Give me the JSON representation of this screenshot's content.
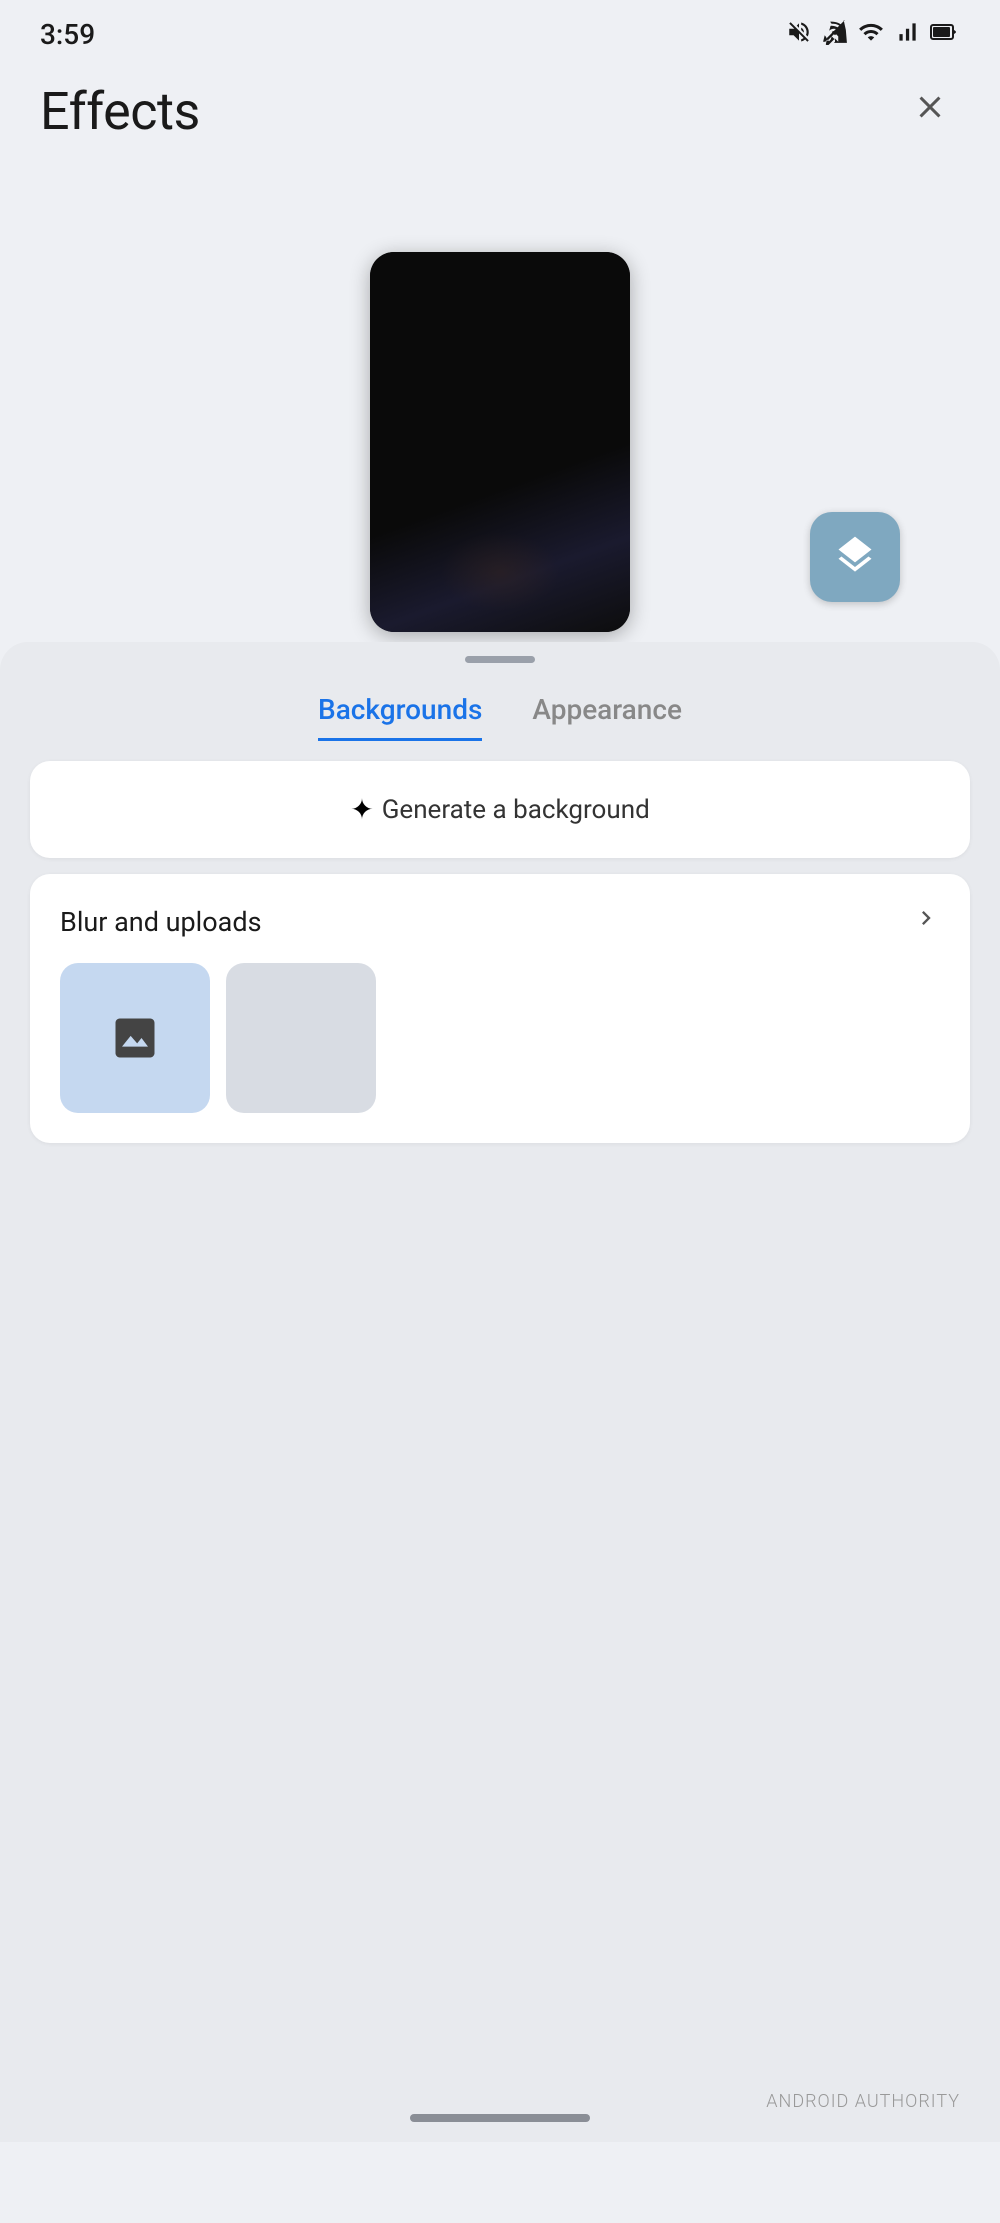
{
  "statusBar": {
    "time": "3:59",
    "icons": [
      "mute",
      "phone-wifi",
      "wifi",
      "signal",
      "battery"
    ]
  },
  "header": {
    "title": "Effects",
    "closeLabel": "×"
  },
  "tabs": [
    {
      "id": "backgrounds",
      "label": "Backgrounds",
      "active": true
    },
    {
      "id": "appearance",
      "label": "Appearance",
      "active": false
    }
  ],
  "generateBtn": {
    "icon": "✦",
    "label": " Generate a background"
  },
  "blurSection": {
    "title": "Blur and uploads",
    "chevron": "›"
  },
  "attribution": "ANDROID AUTHORITY",
  "bottomHandle": "",
  "layersIcon": "◈"
}
